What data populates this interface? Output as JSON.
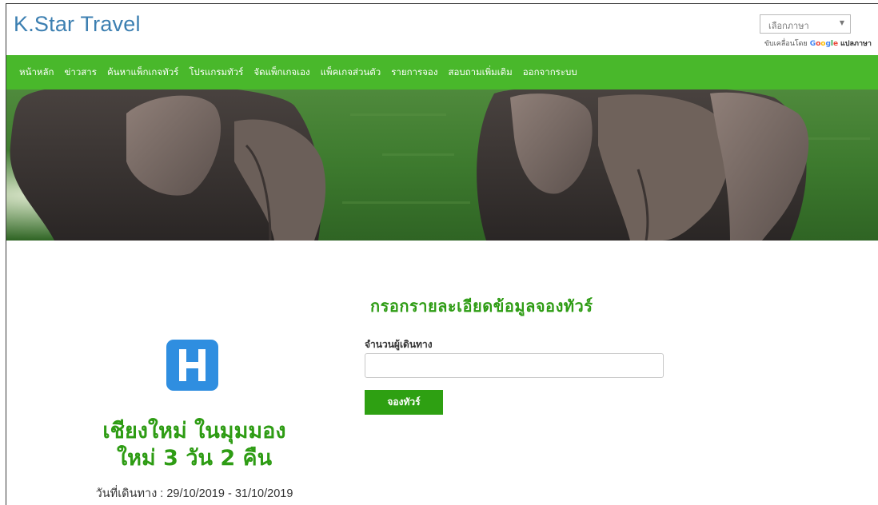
{
  "header": {
    "brand": "K.Star Travel",
    "language_select": {
      "value": "เลือกภาษา"
    },
    "powered_by": "ขับเคลื่อนโดย",
    "google_letters": [
      "G",
      "o",
      "o",
      "g",
      "l",
      "e"
    ],
    "translate_label": "แปลภาษา"
  },
  "nav": {
    "items": [
      {
        "label": "หน้าหลัก"
      },
      {
        "label": "ข่าวสาร"
      },
      {
        "label": "ค้นหาแพ็กเกจทัวร์"
      },
      {
        "label": "โปรแกรมทัวร์"
      },
      {
        "label": "จัดแพ็กเกจเอง"
      },
      {
        "label": "แพ็คเกจส่วนตัว"
      },
      {
        "label": "รายการจอง"
      },
      {
        "label": "สอบถามเพิ่มเติม"
      },
      {
        "label": "ออกจากระบบ"
      }
    ]
  },
  "package": {
    "title_line1": "เชียงใหม่ ในมุมมอง",
    "title_line2": "ใหม่ 3 วัน 2 คืน",
    "date_text": "วันที่เดินทาง : 29/10/2019 - 31/10/2019",
    "icon": "hotel-icon"
  },
  "form": {
    "title": "กรอกรายละเอียดข้อมูลจองทัวร์",
    "travelers_label": "จำนวนผู้เดินทาง",
    "travelers_value": "",
    "submit_label": "จองทัวร์"
  },
  "colors": {
    "brand": "#3c7fb1",
    "nav": "#49b82b",
    "accent_green": "#2e9c14",
    "hotel_icon": "#2f8ee0",
    "google": [
      "#4285F4",
      "#EA4335",
      "#FBBC05",
      "#4285F4",
      "#34A853",
      "#EA4335"
    ]
  }
}
